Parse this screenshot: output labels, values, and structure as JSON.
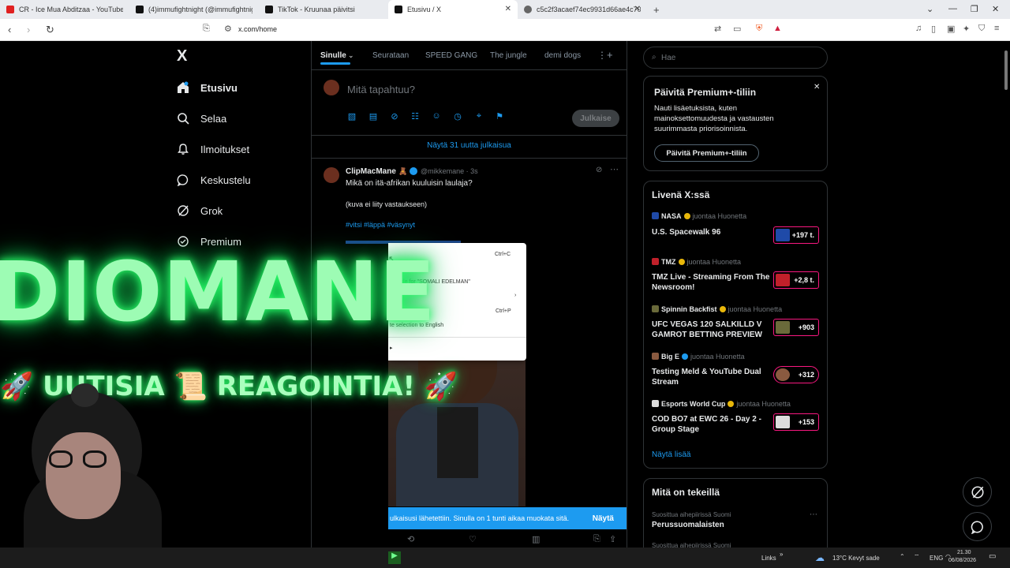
{
  "browser": {
    "tabs": [
      {
        "title": "CR - Ice Mua Abditzaa - YouTube",
        "favicon_color": "#e02020",
        "active": false
      },
      {
        "title": "(4)immufightnight (@immufightnigh",
        "favicon_color": "#111111",
        "active": false
      },
      {
        "title": "TikTok - Kruunaa päivitsi",
        "favicon_color": "#111111",
        "active": false
      },
      {
        "title": "Etusivu / X",
        "favicon_color": "#111111",
        "active": true
      },
      {
        "title": "c5c2f3acaef74ec9931d66ae4c70507c",
        "favicon_color": "#555555",
        "active": false
      }
    ],
    "new_tab": "+",
    "url": "x.com/home"
  },
  "sidebar": {
    "logo": "X",
    "items": [
      {
        "label": "Etusivu",
        "icon": "home-icon",
        "active": true
      },
      {
        "label": "Selaa",
        "icon": "search-icon"
      },
      {
        "label": "Ilmoitukset",
        "icon": "bell-icon"
      },
      {
        "label": "Keskustelu",
        "icon": "chat-icon"
      },
      {
        "label": "Grok",
        "icon": "grok-icon"
      },
      {
        "label": "Premium",
        "icon": "premium-icon"
      }
    ]
  },
  "feed": {
    "tabs": [
      "Sinulle",
      "Seurataan",
      "SPEED GANG",
      "The jungle",
      "demi dogs"
    ],
    "compose_placeholder": "Mitä tapahtuu?",
    "post_button": "Julkaise",
    "new_posts": "Näytä 31 uutta julkaisua",
    "tweet": {
      "author": "ClipMacMane",
      "handle": "@mikkemane · 3s",
      "line1": "Mikä on itä-afrikan kuuluisin laulaja?",
      "line2": "(kuva ei liity vastaukseen)",
      "hashtags": "#vitsi #läppä #väsynyt"
    },
    "toast": {
      "text": "ulkaisusi lähetettiin. Sinulla on 1 tunti aikaa muokata sitä.",
      "link": "Näytä"
    }
  },
  "context_menu": {
    "items": [
      {
        "label": "",
        "shortcut": "Ctrl+C"
      },
      {
        "label": "ink to highlight",
        "shortcut": ""
      },
      {
        "label": "Google for \"SOMALI EDELMAN\"",
        "shortcut": ""
      },
      {
        "label": "tools",
        "shortcut": "›"
      },
      {
        "label": "",
        "shortcut": "Ctrl+P"
      },
      {
        "label": "te selection to English",
        "shortcut": ""
      }
    ]
  },
  "right": {
    "search_placeholder": "Hae",
    "premium": {
      "title": "Päivitä Premium+-tiliin",
      "body": "Nauti lisäetuksista, kuten mainoksettomuudesta ja vastausten suurimmasta priorisoinnista.",
      "button": "Päivitä Premium+-tiliin"
    },
    "live": {
      "title": "Livenä X:ssä",
      "items": [
        {
          "name": "NASA",
          "sub": "juontaa Huonetta",
          "title": "U.S. Spacewalk 96",
          "count": "+197 t.",
          "thumb": "#1f4aa8"
        },
        {
          "name": "TMZ",
          "sub": "juontaa Huonetta",
          "title": "TMZ Live - Streaming From The Newsroom!",
          "count": "+2,8 t.",
          "thumb": "#c0202a"
        },
        {
          "name": "Spinnin Backfist",
          "sub": "juontaa Huonetta",
          "title": "UFC VEGAS 120 SALKILLD V GAMROT BETTING PREVIEW",
          "count": "+903",
          "thumb": "#6a6a3a"
        },
        {
          "name": "Big E",
          "sub": "juontaa Huonetta",
          "title": "Testing Meld & YouTube Dual Stream",
          "count": "+312",
          "thumb": "#8a5a40"
        },
        {
          "name": "Esports World Cup",
          "sub": "juontaa Huonetta",
          "title": "COD BO7 at EWC 26 - Day 2 - Group Stage",
          "count": "+153",
          "thumb": "#dddddd"
        }
      ],
      "show_more": "Näytä lisää"
    },
    "whats_happening": {
      "title": "Mitä on tekeillä",
      "item_sub": "Suosittua aihepiirissä Suomi",
      "item_title": "Perussuomalaisten",
      "item2_sub": "Suosittua aihepiirissä Suomi"
    }
  },
  "overlay": {
    "title": "DIOMANE",
    "subtitle": "🚀 UUTISIA 📜 REAGOINTIA! 🚀"
  },
  "taskbar": {
    "links": "Links",
    "weather": "13°C  Kevyt sade",
    "lang": "ENG",
    "time": "21.30",
    "date": "06/08/2026"
  },
  "colors": {
    "accent": "#1d9bf0",
    "pink": "#f91880",
    "neon": "#2dff6a"
  }
}
